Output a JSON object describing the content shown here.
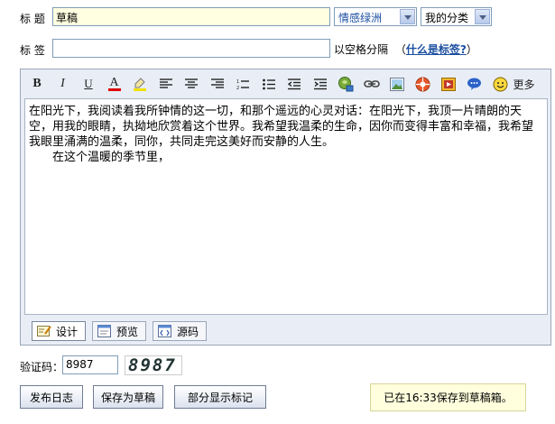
{
  "form": {
    "title_label": "标 题",
    "title_value": "草稿",
    "category_select": "情感绿洲",
    "my_category_select": "我的分类",
    "tag_label": "标 签",
    "tag_value": "",
    "tag_hint_prefix": "以空格分隔",
    "tag_hint_open": "（",
    "tag_hint_link": "什么是标签?",
    "tag_hint_close": "）"
  },
  "toolbar": {
    "bold": "B",
    "italic": "I",
    "underline": "U",
    "font_color": "A",
    "more": "更多",
    "icons": [
      "bold-icon",
      "italic-icon",
      "underline-icon",
      "font-color-icon",
      "highlight-icon",
      "align-left-icon",
      "align-center-icon",
      "align-right-icon",
      "ordered-list-icon",
      "unordered-list-icon",
      "outdent-icon",
      "indent-icon",
      "insert-music-icon",
      "insert-link-icon",
      "insert-image-icon",
      "insert-media-icon",
      "insert-flash-icon",
      "insert-emoticon-bubble-icon",
      "smiley-icon"
    ]
  },
  "content": {
    "paragraph1": "在阳光下，我阅读着我所钟情的这一切，和那个遥远的心灵对话：在阳光下，我顶一片晴朗的天空，用我的眼睛，执拗地欣赏着这个世界。我希望我温柔的生命，因你而变得丰富和幸福，我希望我眼里涌满的温柔，同你，共同走完这美好而安静的人生。",
    "paragraph2": "在这个温暖的季节里，"
  },
  "modes": {
    "design": "设计",
    "preview": "预览",
    "source": "源码"
  },
  "verify": {
    "label": "验证码：",
    "value": "8987",
    "captcha_text": "8987"
  },
  "buttons": {
    "publish": "发布日志",
    "save_draft": "保存为草稿",
    "partial_tag": "部分显示标记"
  },
  "status": {
    "saved_message": "已在16:33保存到草稿箱。"
  },
  "colors": {
    "title_bg": "#ffffe1",
    "editor_bg": "#e9eef6",
    "link": "#1c4fa0",
    "status_bg": "#ffffdd"
  }
}
